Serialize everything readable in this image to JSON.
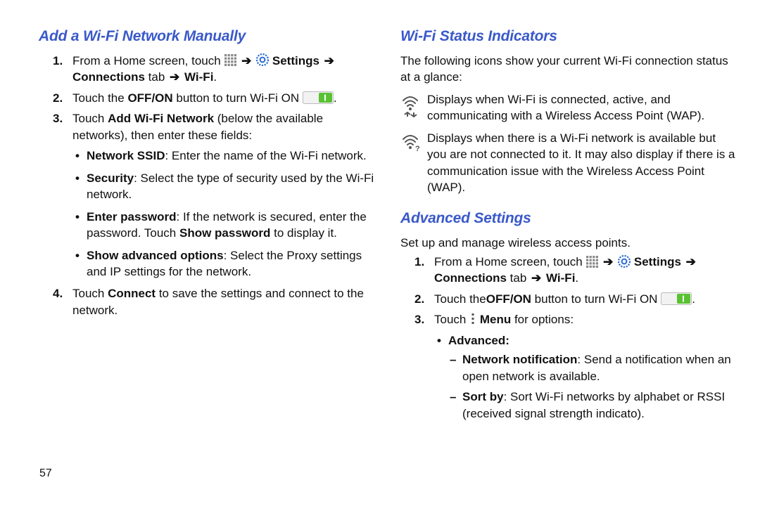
{
  "pagenum": "57",
  "left": {
    "heading": "Add a Wi-Fi Network Manually",
    "step1_a": "From a Home screen, touch ",
    "settings": "Settings",
    "connections_tab": "Connections",
    "wifi": "Wi-Fi",
    "tab_word": " tab ",
    "step2_a": "Touch the ",
    "step2_b": "OFF/ON",
    "step2_c": " button to turn Wi-Fi ON ",
    "step3_a": "Touch ",
    "step3_b": "Add Wi-Fi Network",
    "step3_c": " (below the available networks), then enter these fields:",
    "b1_a": "Network SSID",
    "b1_b": ": Enter the name of the Wi-Fi network.",
    "b2_a": "Security",
    "b2_b": ": Select the type of security used by the Wi-Fi network.",
    "b3_a": "Enter password",
    "b3_b": ": If the network is secured, enter the password. Touch ",
    "b3_c": "Show password",
    "b3_d": " to display it.",
    "b4_a": "Show advanced options",
    "b4_b": ": Select the Proxy settings and IP settings for the network.",
    "step4_a": "Touch ",
    "step4_b": "Connect",
    "step4_c": " to save the settings and connect to the network."
  },
  "right_a": {
    "heading": "Wi-Fi Status Indicators",
    "intro": "The following icons show your current Wi-Fi connection status at a glance:",
    "ind1": "Displays when Wi-Fi is connected, active, and communicating with a Wireless Access Point (WAP).",
    "ind2": "Displays when there is a Wi-Fi network is available but you are not connected to it. It may also display if there is a communication issue with the Wireless Access Point (WAP)."
  },
  "right_b": {
    "heading": "Advanced Settings",
    "intro": "Set up and manage wireless access points.",
    "step1_a": "From a Home screen, touch ",
    "settings": "Settings",
    "connections_tab": "Connections",
    "wifi": "Wi-Fi",
    "tab_word": " tab ",
    "step2_a": "Touch the",
    "step2_b": "OFF/ON",
    "step2_c": "  button to turn Wi-Fi ON ",
    "step3_a": "Touch ",
    "step3_b": "Menu",
    "step3_c": " for options:",
    "adv_label": "Advanced:",
    "d1_a": "Network notification",
    "d1_b": ": Send a notification when an open network is available.",
    "d2_a": "Sort by",
    "d2_b": ": Sort Wi-Fi networks by alphabet or RSSI (received signal strength indicato)."
  }
}
